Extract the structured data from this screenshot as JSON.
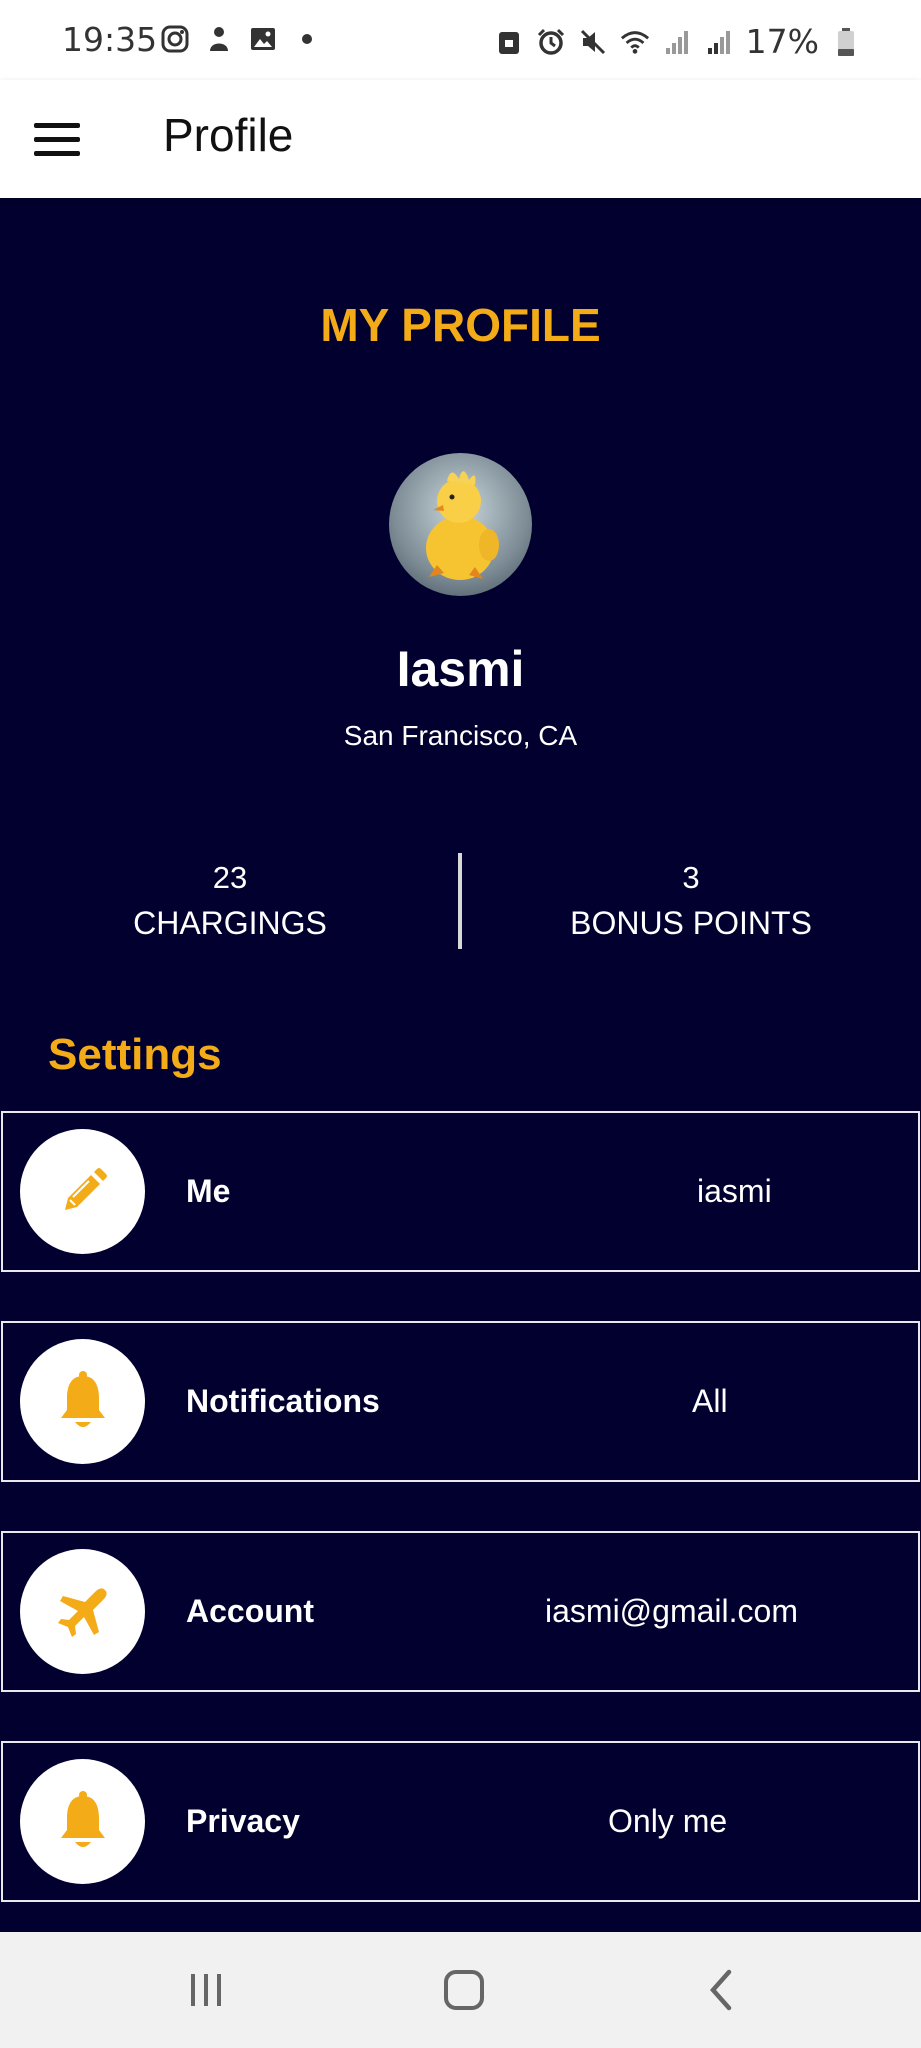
{
  "status_bar": {
    "time": "19:35",
    "battery": "17%",
    "left_icons": [
      "instagram-icon",
      "app-notification-icon",
      "image-icon",
      "dot-icon"
    ],
    "right_icons": [
      "lock-icon",
      "alarm-icon",
      "mute-icon",
      "wifi-icon",
      "signal-icon",
      "signal-roaming-icon",
      "battery-icon"
    ]
  },
  "app_bar": {
    "title": "Profile",
    "menu_icon": "hamburger-menu-icon"
  },
  "profile": {
    "section_title": "MY PROFILE",
    "name": "Iasmi",
    "location": "San Francisco, CA",
    "stats": [
      {
        "value": "23",
        "label": "CHARGINGS"
      },
      {
        "value": "3",
        "label": "BONUS POINTS"
      }
    ]
  },
  "settings": {
    "title": "Settings",
    "items": [
      {
        "label": "Me",
        "value": "iasmi",
        "icon": "pencil-icon"
      },
      {
        "label": "Notifications",
        "value": "All",
        "icon": "bell-icon"
      },
      {
        "label": "Account",
        "value": "iasmi@gmail.com",
        "icon": "airplane-icon"
      },
      {
        "label": "Privacy",
        "value": "Only me",
        "icon": "bell-icon"
      }
    ]
  },
  "nav_bar": {
    "buttons": [
      "recent-apps-icon",
      "home-icon",
      "back-icon"
    ]
  },
  "colors": {
    "background": "#02002f",
    "accent": "#f3ab17",
    "text": "#ffffff"
  }
}
